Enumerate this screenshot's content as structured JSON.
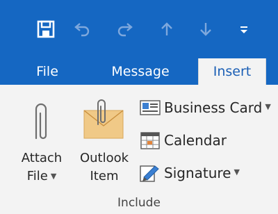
{
  "quick_access": {
    "icons": [
      "save-icon",
      "undo-icon",
      "redo-icon",
      "up-arrow-icon",
      "down-arrow-icon",
      "customize-toolbar-icon"
    ]
  },
  "tabs": [
    {
      "label": "File",
      "active": false
    },
    {
      "label": "Message",
      "active": false
    },
    {
      "label": "Insert",
      "active": true
    }
  ],
  "ribbon": {
    "attach_file": {
      "line1": "Attach",
      "line2": "File",
      "has_dropdown": true,
      "icon": "paperclip-icon"
    },
    "outlook_item": {
      "line1": "Outlook",
      "line2": "Item",
      "icon": "envelope-paperclip-icon"
    },
    "business_card": {
      "label": "Business Card",
      "has_dropdown": true,
      "icon": "business-card-icon"
    },
    "calendar": {
      "label": "Calendar",
      "icon": "calendar-icon"
    },
    "signature": {
      "label": "Signature",
      "has_dropdown": true,
      "icon": "signature-icon"
    },
    "group_label": "Include"
  },
  "colors": {
    "title_bar": "#1567c2",
    "active_tab_text": "#1b5fb5",
    "ribbon_bg": "#f3f3f3"
  }
}
